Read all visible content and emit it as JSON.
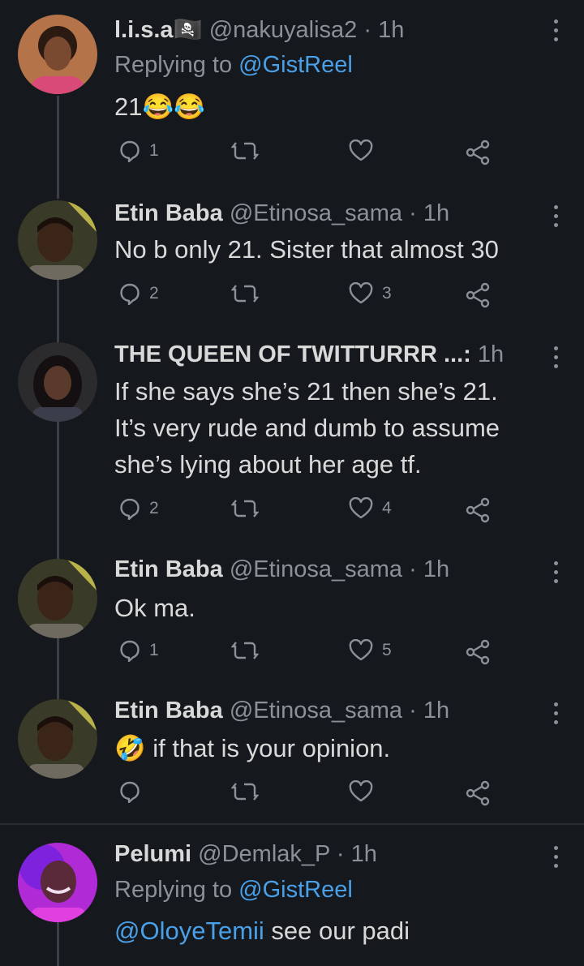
{
  "tweets": [
    {
      "name": "l.i.s.a🏴‍☠️",
      "handle": "@nakuyalisa2",
      "time": "1h",
      "reply_prefix": "Replying to ",
      "reply_to": "@GistReel",
      "text": "21",
      "emojis": "😂😂",
      "replies": "1",
      "retweets": "",
      "likes": ""
    },
    {
      "name": "Etin Baba",
      "handle": "@Etinosa_sama",
      "time": "1h",
      "text": "No b only 21. Sister that almost 30",
      "replies": "2",
      "retweets": "",
      "likes": "3"
    },
    {
      "name": "THE QUEEN OF TWITTURRR ...:",
      "handle": "",
      "time": "1h",
      "text_lines": [
        "If she says she’s 21 then she’s 21.",
        "It’s very rude and dumb to assume",
        "she’s lying about her age tf."
      ],
      "replies": "2",
      "retweets": "",
      "likes": "4"
    },
    {
      "name": "Etin Baba",
      "handle": "@Etinosa_sama",
      "time": "1h",
      "text": "Ok ma.",
      "replies": "1",
      "retweets": "",
      "likes": "5"
    },
    {
      "name": "Etin Baba",
      "handle": "@Etinosa_sama",
      "time": "1h",
      "emoji": "🤣",
      "text": " if that is your opinion.",
      "replies": "",
      "retweets": "",
      "likes": ""
    },
    {
      "name": "Pelumi",
      "handle": "@Demlak_P",
      "time": "1h",
      "reply_prefix": "Replying to ",
      "reply_to": "@GistReel",
      "mention": "@OloyeTemii",
      "text": " see our padi"
    }
  ],
  "separator": " · ",
  "colors": {
    "background": "#15181c",
    "text": "#d9d9d9",
    "muted": "#8b9198",
    "link": "#4aa0e8"
  }
}
